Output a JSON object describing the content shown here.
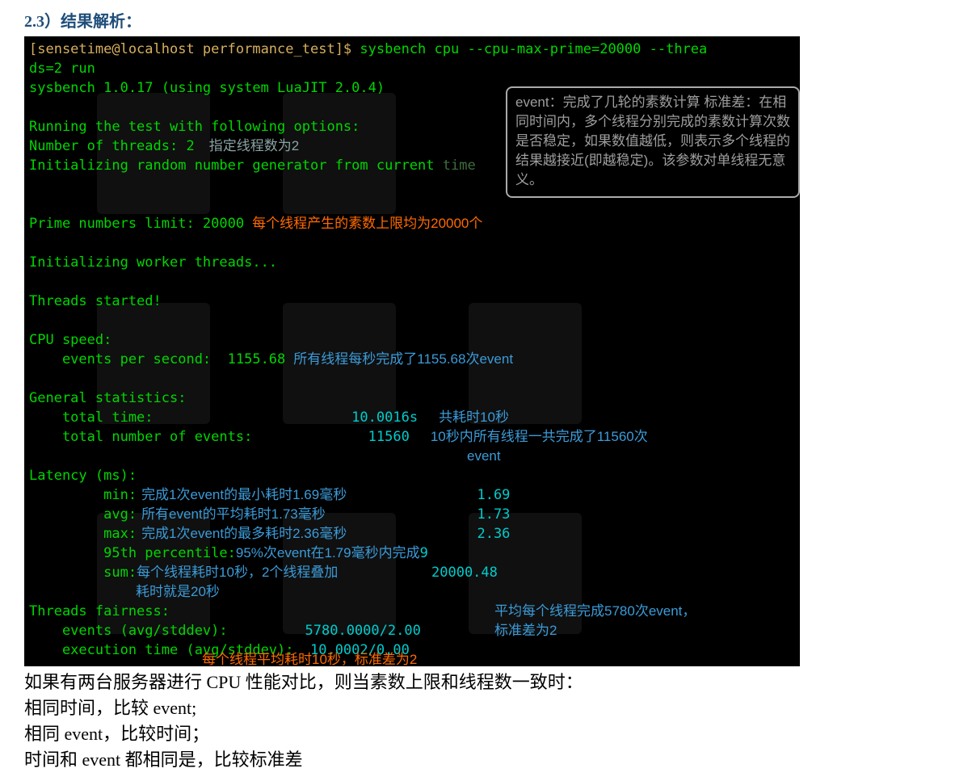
{
  "heading": "2.3）结果解析：",
  "term": {
    "prompt": "[sensetime@localhost performance_test]$ ",
    "cmd1": "sysbench cpu --cpu-max-prime=20000 --threa",
    "cmd2": "ds=2 run",
    "version": "sysbench 1.0.17 (using system LuaJIT 2.0.4)",
    "running": "Running the test with following options:",
    "threads": "Number of threads: 2",
    "threads_note": "指定线程数为2",
    "initrng": "Initializing random number generator from current ",
    "initrng_tail": "time",
    "prime_label": "Prime numbers limit: 20000",
    "prime_note": "每个线程产生的素数上限均为20000个",
    "initworkers": "Initializing worker threads...",
    "started": "Threads started!",
    "cpuspeed": "CPU speed:",
    "eps_label": "    events per second:  1155.68",
    "eps_note": "所有线程每秒完成了1155.68次event",
    "genstats": "General statistics:",
    "tot_time_label": "    total time:                        ",
    "tot_time_val": "10.0016s",
    "tot_time_note": "共耗时10秒",
    "tot_events_label": "    total number of events:            ",
    "tot_events_val": "  11560",
    "tot_events_note1": "10秒内所有线程一共完成了11560次",
    "tot_events_note2": "event",
    "latency": "Latency (ms):",
    "min_label": "         min:",
    "min_note": "完成1次event的最小耗时1.69毫秒",
    "min_val": "  1.69",
    "avg_label": "         avg:",
    "avg_note": "所有event的平均耗时1.73毫秒",
    "avg_val": "  1.73",
    "max_label": "         max:",
    "max_note": "完成1次event的最多耗时2.36毫秒",
    "max_val": "  2.36",
    "pct_label": "         95th percentile:",
    "pct_note": "95%次event在1.79毫秒内完成",
    "pct_val": "9",
    "sum_label": "         sum:",
    "sum_note1": "每个线程耗时10秒，2个线程叠加",
    "sum_val": "20000.48",
    "sum_note2": "耗时就是20秒",
    "fairness": "Threads fairness:",
    "fair_note1": "平均每个线程完成5780次event，",
    "fair_note2": "标准差为2",
    "evt_label": "    events (avg/stddev):        ",
    "evt_val": "5780.0000/2.00",
    "exec_label": "    execution time (avg/stddev):",
    "exec_val": "  10.0002/0.00",
    "exec_note": "每个线程平均耗时10秒，标准差为2",
    "callout": "event：完成了几轮的素数计算\n标准差：在相同时间内，多个线程分别完成的素数计算次数是否稳定，如果数值越低，则表示多个线程的结果越接近(即越稳定)。该参数对单线程无意义。"
  },
  "body": {
    "l1": "如果有两台服务器进行 CPU 性能对比，则当素数上限和线程数一致时：",
    "l2": "相同时间，比较 event;",
    "l3": "相同 event，比较时间；",
    "l4": "时间和 event 都相同是，比较标准差"
  }
}
